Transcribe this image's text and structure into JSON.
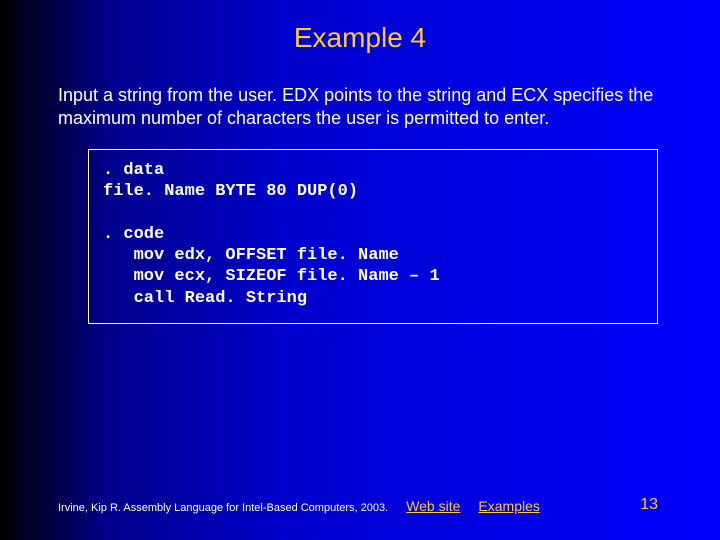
{
  "title": "Example 4",
  "body_text": "Input a string from the user. EDX points to the string and ECX specifies the maximum number of characters the user is permitted to enter.",
  "code": {
    "data_section": ". data\nfile. Name BYTE 80 DUP(0)",
    "code_section": ". code\n   mov edx, OFFSET file. Name\n   mov ecx, SIZEOF file. Name – 1\n   call Read. String"
  },
  "footer": {
    "citation": "Irvine, Kip R. Assembly Language for Intel-Based Computers, 2003.",
    "links": {
      "web_site": "Web site",
      "examples": "Examples"
    }
  },
  "page_number": "13"
}
